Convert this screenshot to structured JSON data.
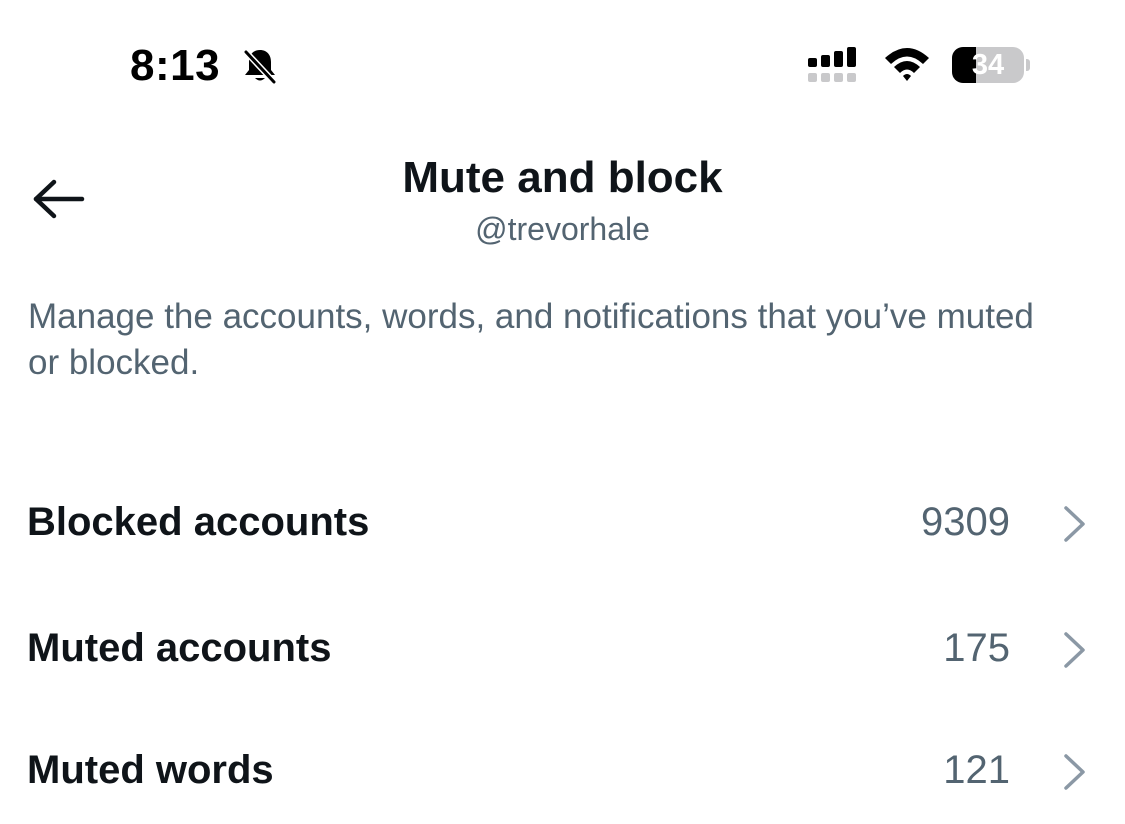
{
  "status_bar": {
    "time": "8:13",
    "battery_level": "34",
    "battery_fraction": 0.34,
    "icons": [
      "bell-slash-icon",
      "cellular-signal-icon",
      "wifi-icon",
      "battery-icon"
    ]
  },
  "header": {
    "back_icon": "arrow-left-icon",
    "title": "Mute and block",
    "subtitle": "@trevorhale"
  },
  "description": "Manage the accounts, words, and notifications that you’ve muted or blocked.",
  "rows": [
    {
      "label": "Blocked accounts",
      "count": "9309",
      "icon": "chevron-right-icon"
    },
    {
      "label": "Muted accounts",
      "count": "175",
      "icon": "chevron-right-icon"
    },
    {
      "label": "Muted words",
      "count": "121",
      "icon": "chevron-right-icon"
    }
  ],
  "colors": {
    "primary_text": "#0f1419",
    "secondary_text": "#536471",
    "chevron": "#8b98a5",
    "background": "#ffffff"
  }
}
